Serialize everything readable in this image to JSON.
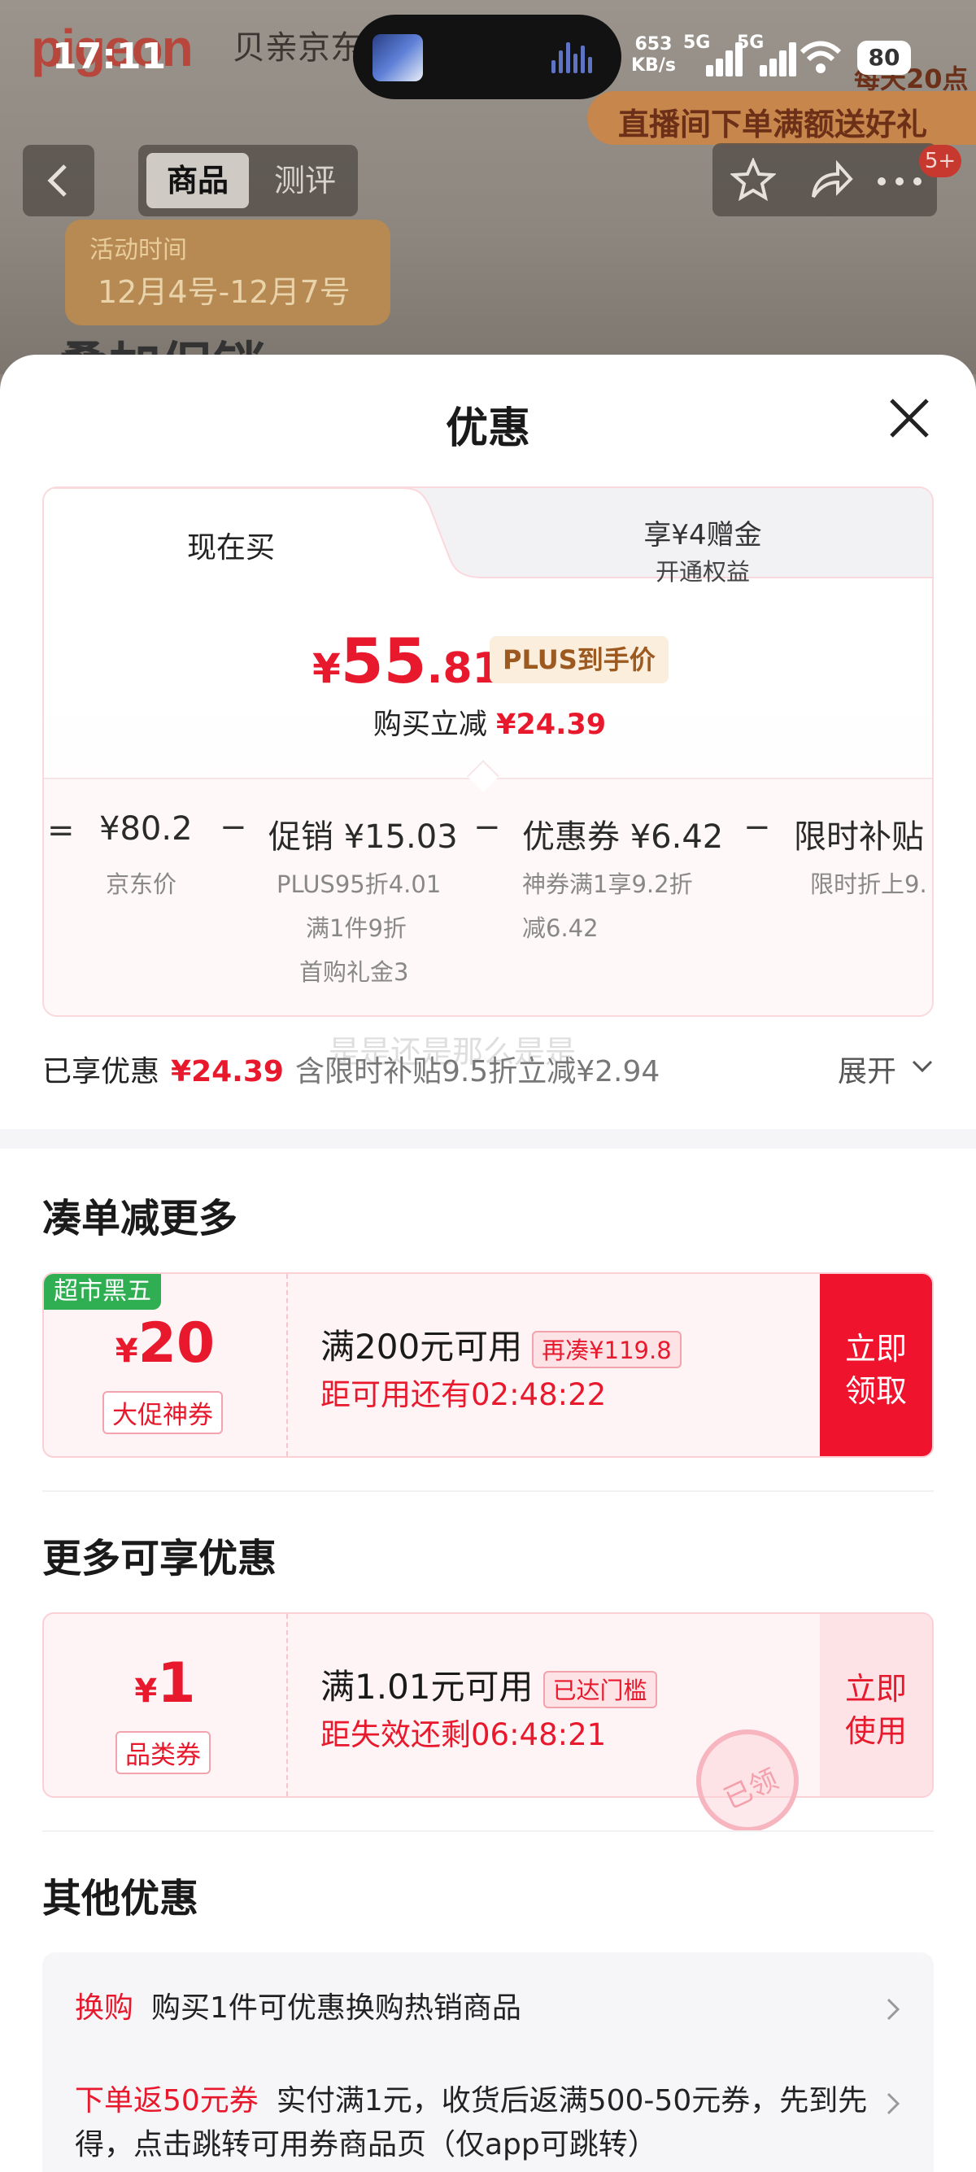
{
  "status_bar": {
    "time": "17:11",
    "net_speed_value": "653",
    "net_speed_unit": "KB/s",
    "signal1": "5G",
    "signal2": "5G",
    "battery": "80"
  },
  "background_page": {
    "logo": "pigeon",
    "shop_name": "贝亲京东",
    "live_banner_top": "每天20点",
    "live_banner_text": "直播间下单满额送好礼",
    "activity_title": "活动时间",
    "activity_date": "12月4号-12月7号",
    "promo_text": "叠加促销"
  },
  "top_nav": {
    "tab_goods": "商品",
    "tab_review": "测评",
    "more_badge": "5+"
  },
  "sheet": {
    "title": "优惠",
    "price_card": {
      "tab_now": "现在买",
      "tab_plus_line1": "享¥4赠金",
      "tab_plus_line2": "开通权益",
      "price_currency": "¥",
      "price_int": "55",
      "price_dec": ".81",
      "plus_tag": "PLUS到手价",
      "reduce_label": "购买立减",
      "reduce_value": "¥24.39",
      "breakdown": [
        {
          "op": "=",
          "value": "¥80.2",
          "subs": [
            "京东价"
          ]
        },
        {
          "op": "−",
          "value": "促销 ¥15.03",
          "subs": [
            "PLUS95折4.01",
            "满1件9折",
            "首购礼金3"
          ]
        },
        {
          "op": "−",
          "value": "优惠券 ¥6.42",
          "subs": [
            "神券满1享9.2折",
            "减6.42"
          ]
        },
        {
          "op": "−",
          "value": "限时补贴 ¥",
          "subs": [
            "限时折上9."
          ]
        }
      ]
    },
    "enjoyed": {
      "label": "已享优惠",
      "value": "¥24.39",
      "detail": "含限时补贴9.5折立减¥2.94",
      "expand": "展开",
      "ghost_text": "是是还是那么是是"
    },
    "more_save": {
      "title": "凑单减更多",
      "coupon": {
        "corner_tag": "超市黑五",
        "currency": "¥",
        "amount": "20",
        "kind": "大促神券",
        "condition": "满200元可用",
        "tag": "再凑¥119.8",
        "timer": "距可用还有02:48:22",
        "button_line1": "立即",
        "button_line2": "领取"
      }
    },
    "more_available": {
      "title": "更多可享优惠",
      "coupon": {
        "currency": "¥",
        "amount": "1",
        "kind": "品类券",
        "condition": "满1.01元可用",
        "tag": "已达门槛",
        "timer": "距失效还剩06:48:21",
        "button_line1": "立即",
        "button_line2": "使用",
        "stamp": "已领"
      }
    },
    "other": {
      "title": "其他优惠",
      "rows": [
        {
          "label": "换购",
          "text": "购买1件可优惠换购热销商品"
        },
        {
          "label": "下单返50元券",
          "text": "实付满1元，收货后返满500-50元券，先到先得，点击跳转可用券商品页（仅app可跳转）"
        }
      ]
    }
  },
  "colors": {
    "accent_red": "#e8192c",
    "button_red": "#f0132e",
    "plus_gold": "#9c5a21",
    "black_friday_green": "#2fae52"
  }
}
